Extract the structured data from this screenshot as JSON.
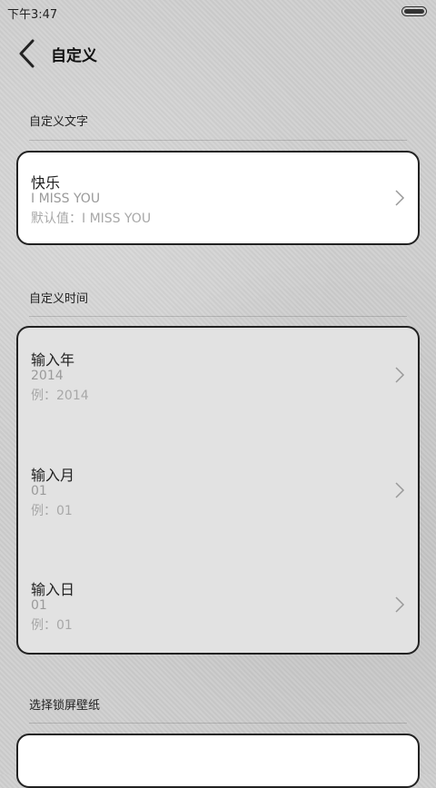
{
  "status": {
    "time": "下午3:47"
  },
  "header": {
    "title": "自定义"
  },
  "sections": {
    "text": {
      "label": "自定义文字",
      "item": {
        "title": "快乐",
        "value": "I MISS YOU",
        "default": "默认值：I MISS YOU"
      }
    },
    "time": {
      "label": "自定义时间",
      "items": [
        {
          "title": "输入年",
          "value": "2014",
          "example": "例：2014"
        },
        {
          "title": "输入月",
          "value": "01",
          "example": "例：01"
        },
        {
          "title": "输入日",
          "value": "01",
          "example": "例：01"
        }
      ]
    },
    "wallpaper": {
      "label": "选择锁屏壁纸"
    }
  }
}
